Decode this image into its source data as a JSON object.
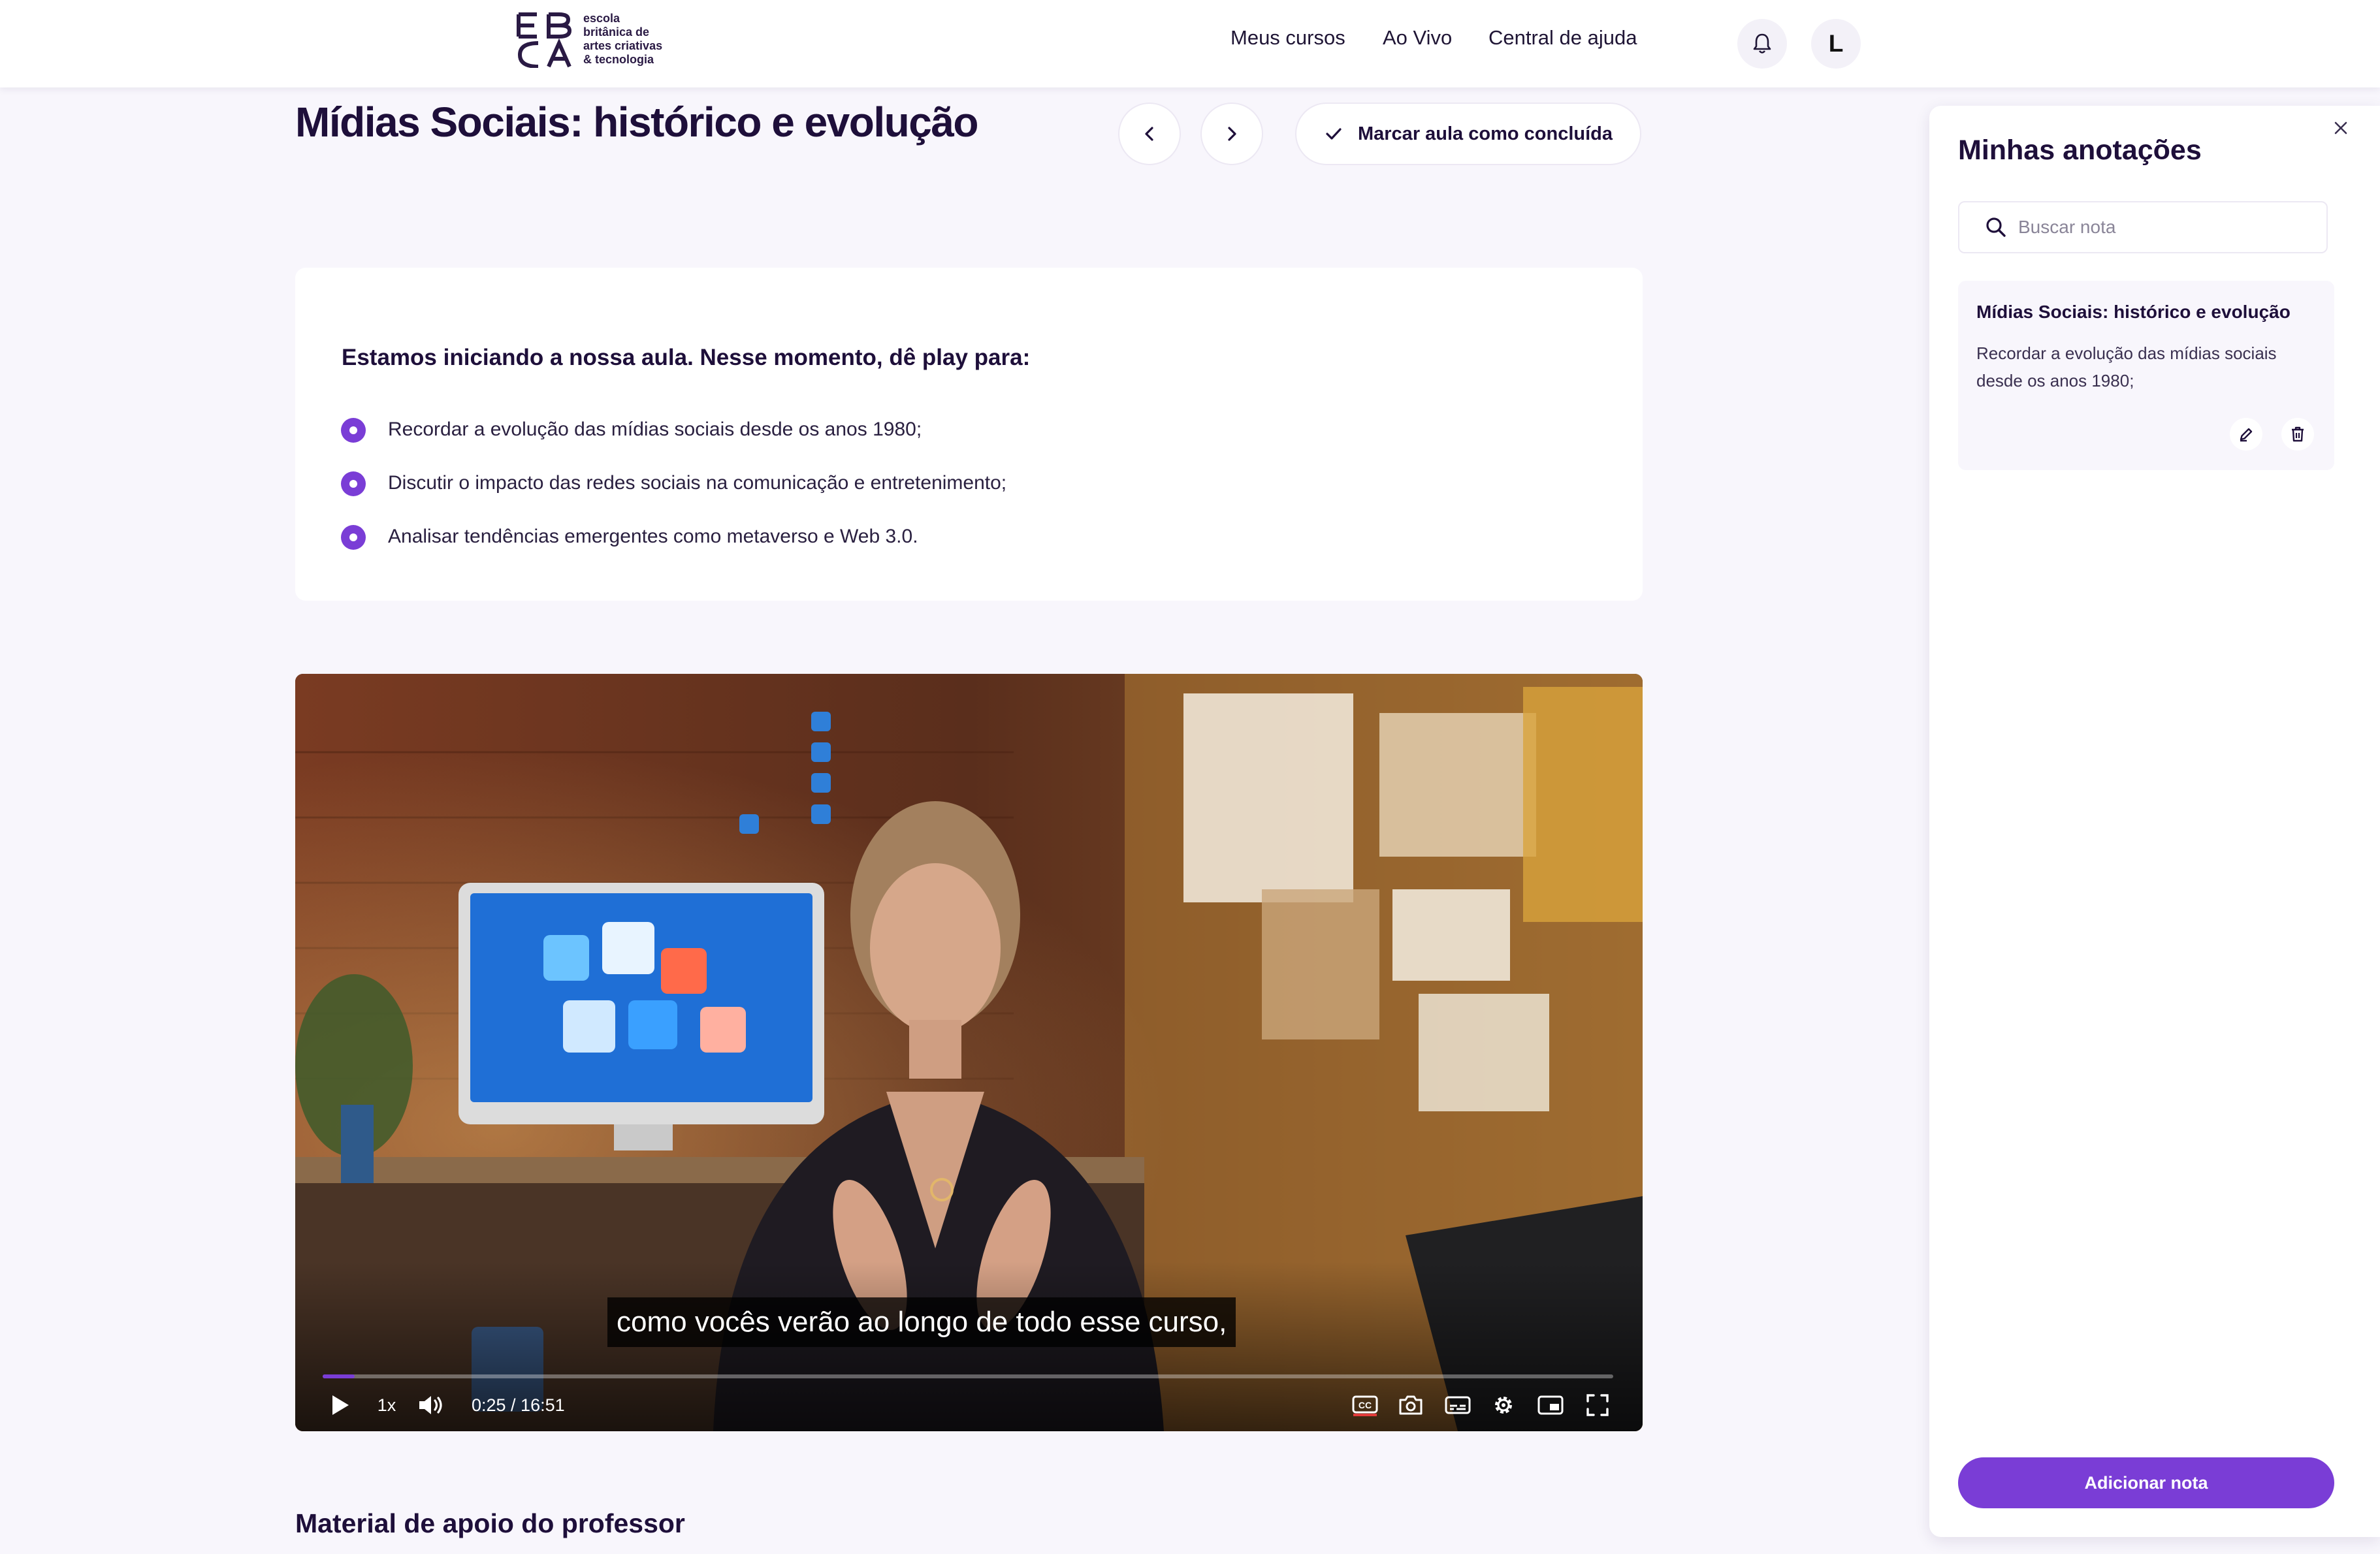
{
  "header": {
    "logo_lines": [
      "escola",
      "britânica de",
      "artes criativas",
      "& tecnologia"
    ],
    "nav": [
      "Meus cursos",
      "Ao Vivo",
      "Central de ajuda"
    ],
    "avatar_initial": "L"
  },
  "lesson": {
    "title": "Mídias Sociais: histórico e evolução",
    "mark_done_label": "Marcar aula como concluída"
  },
  "intro": {
    "heading": "Estamos iniciando a nossa aula. Nesse momento, dê play para:",
    "bullets": [
      "Recordar a evolução das mídias sociais desde os anos 1980;",
      "Discutir o impacto das redes sociais na comunicação e entretenimento;",
      "Analisar tendências emergentes como metaverso e Web 3.0."
    ]
  },
  "video": {
    "subtitle": "como vocês verão ao longo de todo esse curso,",
    "speed": "1x",
    "time": "0:25 / 16:51",
    "progress_fraction": 0.025
  },
  "material": {
    "heading": "Material de apoio do professor"
  },
  "notes": {
    "title": "Minhas anotações",
    "search_placeholder": "Buscar nota",
    "items": [
      {
        "title": "Mídias Sociais: histórico e evolução",
        "body": "Recordar a evolução das mídias sociais desde os anos 1980;"
      }
    ],
    "add_label": "Adicionar nota"
  },
  "colors": {
    "accent": "#7a3dd6",
    "background": "#f8f6fc",
    "text": "#1e0f3a"
  }
}
